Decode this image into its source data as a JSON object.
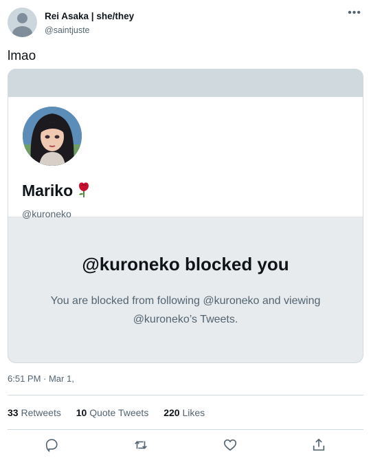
{
  "author": {
    "display_name": "Rei Asaka | she/they",
    "handle": "@saintjuste"
  },
  "tweet": {
    "text": "lmao",
    "timestamp": "6:51 PM · Mar 1,"
  },
  "card": {
    "profile_name": "Mariko",
    "profile_handle": "@kuroneko",
    "blocked_title": "@kuroneko blocked you",
    "blocked_desc": "You are blocked from following @kuroneko and viewing @kuroneko’s Tweets."
  },
  "stats": {
    "retweets_count": "33",
    "retweets_label": "Retweets",
    "quotes_count": "10",
    "quotes_label": "Quote Tweets",
    "likes_count": "220",
    "likes_label": "Likes"
  },
  "icons": {
    "more": "more-horizontal-icon",
    "reply": "reply-icon",
    "retweet": "retweet-icon",
    "like": "heart-icon",
    "share": "share-icon",
    "rose": "rose-emoji"
  },
  "colors": {
    "secondary_text": "#536471",
    "card_bg": "#e7ebee",
    "border": "#cfd9de"
  }
}
